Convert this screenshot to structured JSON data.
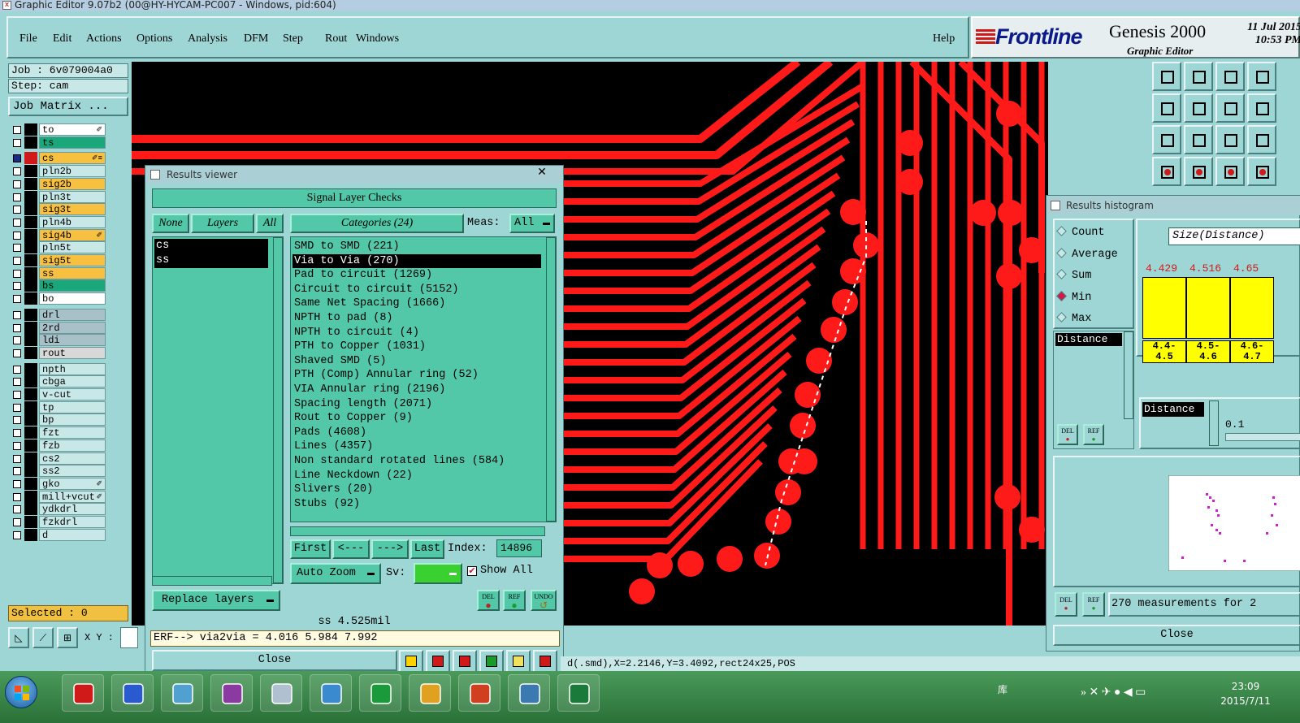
{
  "window": {
    "title": "Graphic Editor 9.07b2 (00@HY-HYCAM-PC007 - Windows, pid:604)"
  },
  "menu": {
    "items": [
      "File",
      "Edit",
      "Actions",
      "Options",
      "Analysis",
      "DFM",
      "Step",
      "Rout",
      "Windows"
    ],
    "help": "Help"
  },
  "brand": {
    "logo": "Frontline",
    "product": "Genesis 2000",
    "subtitle": "Graphic Editor",
    "date": "11 Jul 2015",
    "time": "10:53 PM"
  },
  "job": {
    "job_label": "Job : 6v079004a0",
    "step_label": "Step: cam",
    "matrix_button": "Job Matrix ..."
  },
  "layers": [
    {
      "name": "to",
      "color": "#ffffff",
      "mark": "✐"
    },
    {
      "name": "ts",
      "color": "#1aa87a",
      "mark": ""
    },
    {
      "name": "cs",
      "color": "#f8c040",
      "mark": "✐≡",
      "active": true
    },
    {
      "name": "pln2b",
      "color": "#c8e8e8",
      "mark": ""
    },
    {
      "name": "sig2b",
      "color": "#f8c040",
      "mark": ""
    },
    {
      "name": "pln3t",
      "color": "#c8e8e8",
      "mark": ""
    },
    {
      "name": "sig3t",
      "color": "#f8c040",
      "mark": ""
    },
    {
      "name": "pln4b",
      "color": "#c8e8e8",
      "mark": ""
    },
    {
      "name": "sig4b",
      "color": "#f8c040",
      "mark": "✐"
    },
    {
      "name": "pln5t",
      "color": "#c8e8e8",
      "mark": ""
    },
    {
      "name": "sig5t",
      "color": "#f8c040",
      "mark": ""
    },
    {
      "name": "ss",
      "color": "#f8c040",
      "mark": ""
    },
    {
      "name": "bs",
      "color": "#1aa87a",
      "mark": ""
    },
    {
      "name": "bo",
      "color": "#ffffff",
      "mark": ""
    },
    {
      "name": "drl",
      "color": "#a8c0c8",
      "mark": ""
    },
    {
      "name": "2rd",
      "color": "#a8c0c8",
      "mark": ""
    },
    {
      "name": "ldi",
      "color": "#a8c0c8",
      "mark": ""
    },
    {
      "name": "rout",
      "color": "#d8d8d8",
      "mark": ""
    },
    {
      "name": "npth",
      "color": "#c8e8e8",
      "mark": ""
    },
    {
      "name": "cbga",
      "color": "#c8e8e8",
      "mark": ""
    },
    {
      "name": "v-cut",
      "color": "#c8e8e8",
      "mark": ""
    },
    {
      "name": "tp",
      "color": "#c8e8e8",
      "mark": ""
    },
    {
      "name": "bp",
      "color": "#c8e8e8",
      "mark": ""
    },
    {
      "name": "fzt",
      "color": "#c8e8e8",
      "mark": ""
    },
    {
      "name": "fzb",
      "color": "#c8e8e8",
      "mark": ""
    },
    {
      "name": "cs2",
      "color": "#c8e8e8",
      "mark": ""
    },
    {
      "name": "ss2",
      "color": "#c8e8e8",
      "mark": ""
    },
    {
      "name": "gko",
      "color": "#c8e8e8",
      "mark": "✐"
    },
    {
      "name": "mill+vcut",
      "color": "#c8e8e8",
      "mark": "✐"
    },
    {
      "name": "ydkdrl",
      "color": "#c8e8e8",
      "mark": ""
    },
    {
      "name": "fzkdrl",
      "color": "#c8e8e8",
      "mark": ""
    },
    {
      "name": "d",
      "color": "#c8e8e8",
      "mark": ""
    }
  ],
  "selected": "Selected : 0",
  "coords": {
    "xy_label": "X Y :"
  },
  "results_viewer": {
    "title": "Results viewer",
    "close_x": "✕",
    "heading": "Signal Layer Checks",
    "none_btn": "None",
    "layers_btn": "Layers",
    "all_btn": "All",
    "layer_list": [
      "cs",
      "ss"
    ],
    "categories_btn": "Categories (24)",
    "meas_label": "Meas:",
    "meas_value": "All",
    "categories": [
      "SMD to SMD (221)",
      "Via to Via (270)",
      "Pad to circuit (1269)",
      "Circuit to circuit (5152)",
      "Same Net Spacing (1666)",
      "NPTH to pad (8)",
      "NPTH to circuit (4)",
      "PTH to Copper (1031)",
      "Shaved SMD (5)",
      "PTH (Comp) Annular ring (52)",
      "VIA Annular ring (2196)",
      "Spacing length (2071)",
      "Rout to Copper (9)",
      "Pads (4608)",
      "Lines (4357)",
      "Non standard rotated lines (584)",
      "Line Neckdown (22)",
      "Slivers (20)",
      "Stubs (92)"
    ],
    "selected_category_index": 1,
    "nav": {
      "first": "First",
      "prev": "<---",
      "next": "--->",
      "last": "Last",
      "index_label": "Index:",
      "index_value": "14896"
    },
    "auto_zoom": "Auto Zoom",
    "sv_label": "Sv:",
    "show_all": "Show All",
    "replace_layers": "Replace layers",
    "icon_btns": [
      "DEL",
      "REF",
      "UNDO"
    ],
    "measure_line": "ss 4.525mil",
    "erf_line": "ERF--> via2via = 4.016 5.984 7.992",
    "close": "Close"
  },
  "histogram": {
    "title": "Results histogram",
    "options": [
      "Count",
      "Average",
      "Sum",
      "Min",
      "Max"
    ],
    "selected_option": "Min",
    "size_label": "Size(Distance)",
    "bars": [
      {
        "value": "4.429",
        "range": "4.4-\n4.5"
      },
      {
        "value": "4.516",
        "range": "4.5-\n4.6"
      },
      {
        "value": "4.65",
        "range": "4.6-\n4.7"
      }
    ],
    "distance_list_item": "Distance",
    "distance_box_label": "Distance",
    "distance_value": "0.1",
    "measurements": "270 measurements for 2",
    "close": "Close",
    "icon_btns": [
      "DEL",
      "REF"
    ]
  },
  "status": {
    "text": "d(.smd),X=2.2146,Y=3.4092,rect24x25,POS"
  },
  "taskbar": {
    "lang": "库",
    "time": "23:09",
    "date": "2015/7/11"
  }
}
